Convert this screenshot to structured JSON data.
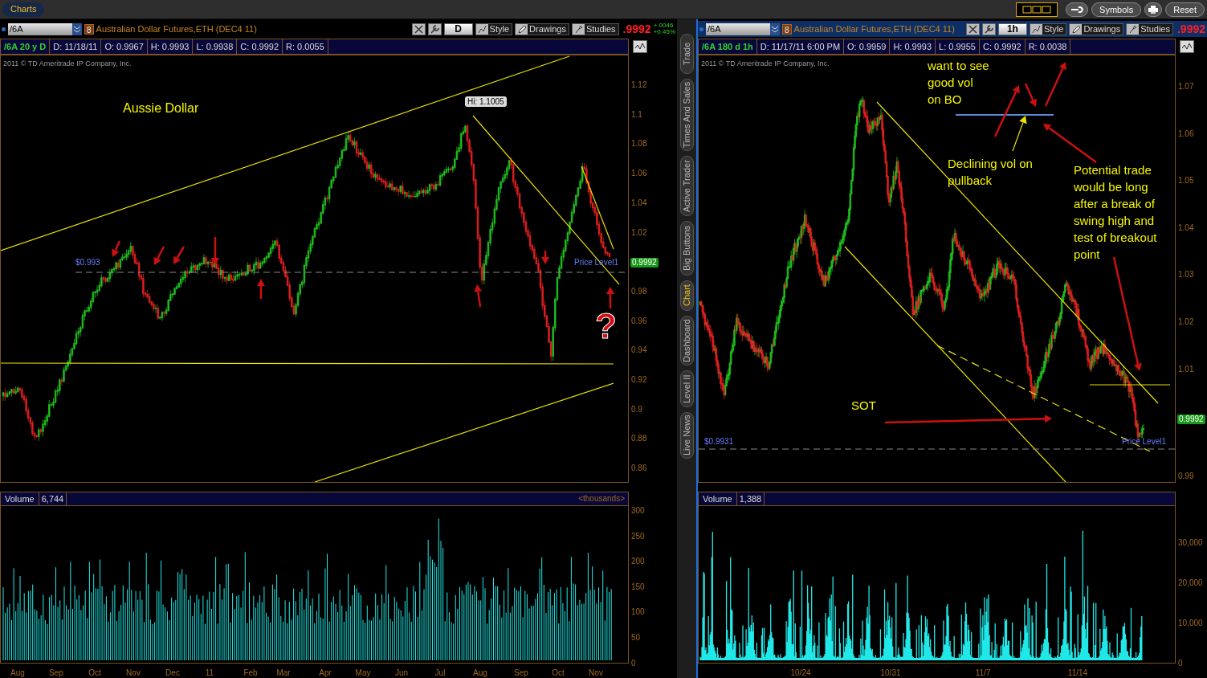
{
  "app_tab": {
    "label": "Charts",
    "selected": true
  },
  "toolbar": {
    "buttons": [
      {
        "kind": "layout"
      },
      {
        "kind": "wrench"
      },
      {
        "kind": "text",
        "label": "Symbols"
      },
      {
        "kind": "print"
      },
      {
        "kind": "text",
        "label": "Reset"
      }
    ]
  },
  "side_tabs": [
    {
      "label": "Trade",
      "selected": false
    },
    {
      "label": "Times And Sales",
      "selected": false
    },
    {
      "label": "Active Trader",
      "selected": false
    },
    {
      "label": "Big Buttons",
      "selected": false
    },
    {
      "label": "Chart",
      "selected": true
    },
    {
      "label": "Dashboard",
      "selected": false
    },
    {
      "label": "Level II",
      "selected": false
    },
    {
      "label": "Live News",
      "selected": false
    }
  ],
  "panels": [
    {
      "selected": false,
      "symbol": "/6A",
      "alert_count": "8",
      "description": "Australian Dollar Futures,ETH (DEC4 11)",
      "aggregation": "D",
      "style_label": "Style",
      "drawings_label": "Drawings",
      "studies_label": "Studies",
      "last": ".9992",
      "change": "+.0046",
      "change_pct": "+0.45%",
      "info": [
        "/6A 20 y D",
        "D: 11/18/11",
        "O: 0.9967",
        "H: 0.9993",
        "L: 0.9938",
        "C: 0.9992",
        "R: 0.0055"
      ],
      "copyright": "2011 © TD Ameritrade IP Company, Inc.",
      "price_axis": [
        "1.12",
        "1.1",
        "1.08",
        "1.06",
        "1.04",
        "1.02",
        "0.98",
        "0.96",
        "0.94",
        "0.92",
        "0.9",
        "0.88",
        "0.86"
      ],
      "price_tag": "0.9992",
      "level_value": "$0.993",
      "level_name": "Price Level1",
      "high_bubble": "Hi: 1.1005",
      "notes": [
        "Aussie Dollar",
        "?"
      ],
      "volume": {
        "label": "Volume",
        "value": "6,744",
        "unit": "<thousands>",
        "axis": [
          "300",
          "250",
          "200",
          "150",
          "100",
          "50",
          "0"
        ]
      },
      "x_axis": [
        "Aug",
        "Sep",
        "Oct",
        "Nov",
        "Dec",
        "11",
        "Feb",
        "Mar",
        "Apr",
        "May",
        "Jun",
        "Jul",
        "Aug",
        "Sep",
        "Oct",
        "Nov"
      ]
    },
    {
      "selected": true,
      "symbol": "/6A",
      "alert_count": "8",
      "description": "Australian Dollar Futures,ETH (DEC4 11)",
      "aggregation": "1h",
      "style_label": "Style",
      "drawings_label": "Drawings",
      "studies_label": "Studies",
      "last": ".9992",
      "info": [
        "/6A 180 d 1h",
        "D: 11/17/11 6:00 PM",
        "O: 0.9959",
        "H: 0.9993",
        "L: 0.9955",
        "C: 0.9992",
        "R: 0.0038"
      ],
      "copyright": "2011 © TD Ameritrade IP Company, Inc.",
      "price_axis": [
        "1.07",
        "1.06",
        "1.05",
        "1.04",
        "1.03",
        "1.02",
        "1.01",
        "0.99"
      ],
      "price_tag": "0.9992",
      "level_value": "$0.9931",
      "level_name": "Price Level1",
      "notes": [
        "want to see\ngood vol\non BO",
        "Declining vol on\npullback",
        "Potential trade\nwould be long\nafter a break of\nswing high and\ntest of breakout\npoint",
        "SOT"
      ],
      "volume": {
        "label": "Volume",
        "value": "1,388",
        "axis": [
          "30,000",
          "20,000",
          "10,000",
          "0"
        ]
      },
      "x_axis": [
        "10/24",
        "10/31",
        "11/7",
        "11/14"
      ]
    }
  ]
}
